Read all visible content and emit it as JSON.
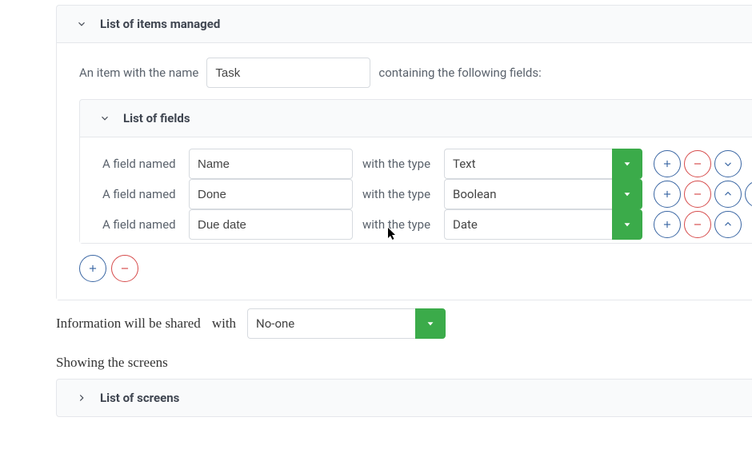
{
  "items_panel": {
    "title": "List of items managed",
    "lead_text": "An item with the name",
    "item_name_value": "Task",
    "trail_text": "containing the following fields:"
  },
  "fields_panel": {
    "title": "List of fields",
    "lead": "A field named",
    "mid": "with the type",
    "rows": [
      {
        "name": "Name",
        "type": "Text"
      },
      {
        "name": "Done",
        "type": "Boolean"
      },
      {
        "name": "Due date",
        "type": "Date"
      }
    ]
  },
  "share": {
    "lead": "Information will be shared",
    "with": "with",
    "value": "No-one"
  },
  "screens": {
    "lead": "Showing the screens",
    "title": "List of screens"
  },
  "colors": {
    "green": "#3bab4a",
    "blue": "#3a66a3",
    "red": "#d64b4b"
  }
}
